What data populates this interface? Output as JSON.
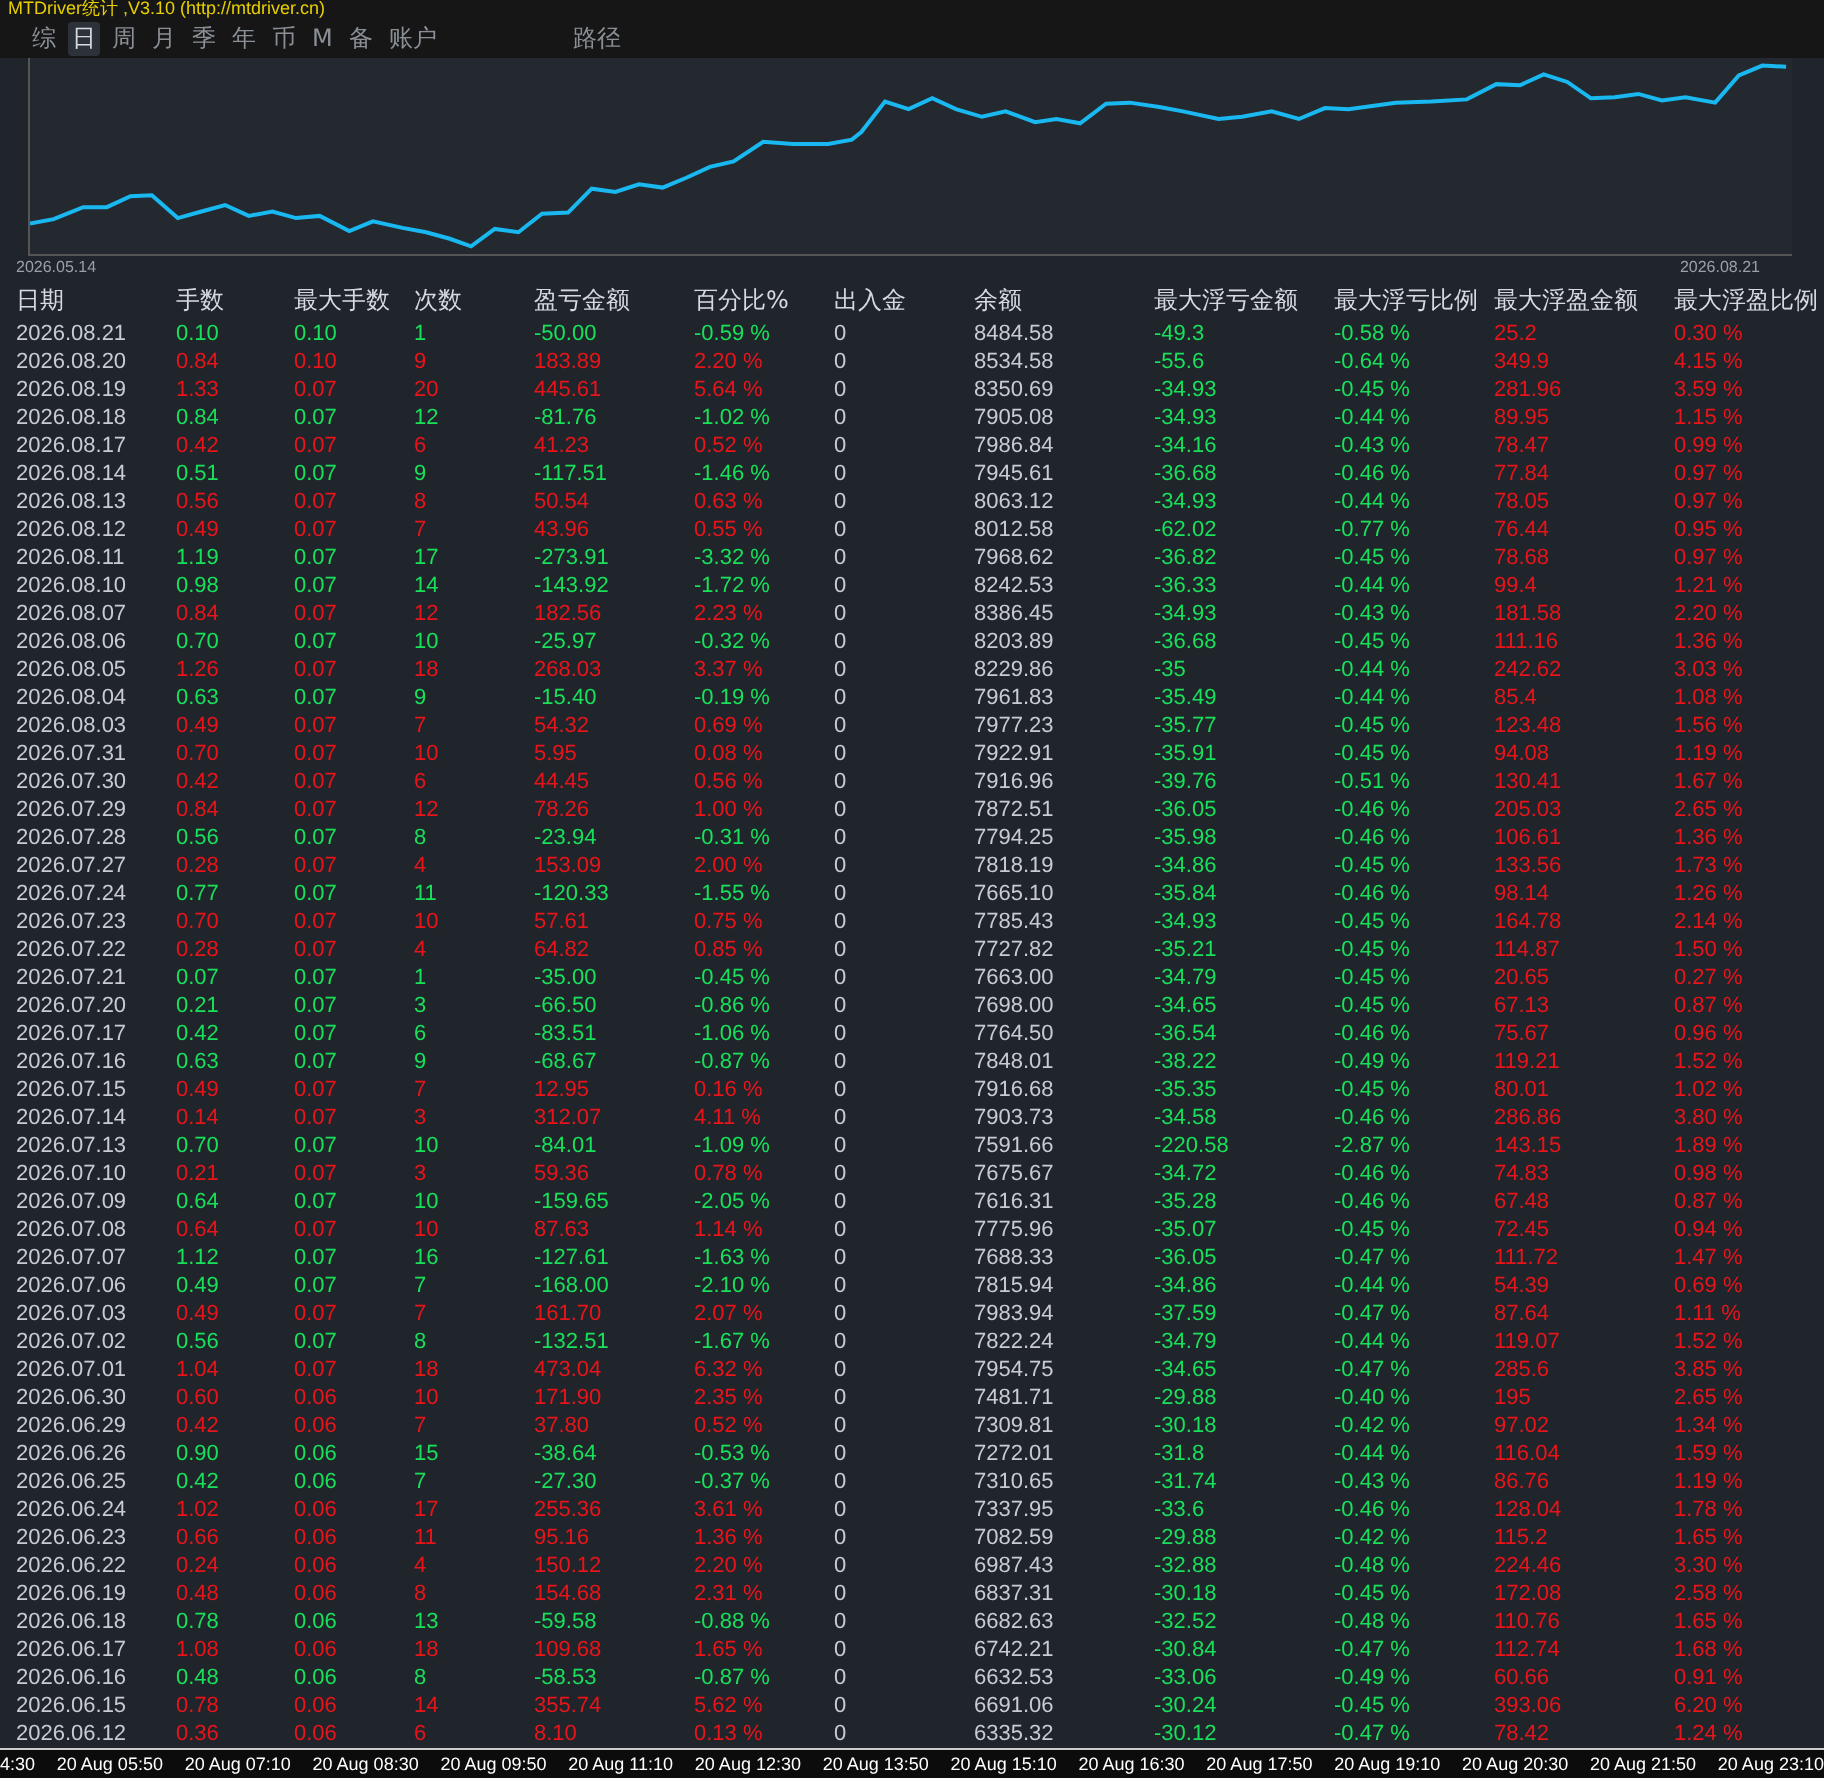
{
  "window": {
    "title": "MTDriver统计 ,V3.10 (http://mtdriver.cn)"
  },
  "tabs": [
    {
      "label": "综",
      "selected": false
    },
    {
      "label": "日",
      "selected": true
    },
    {
      "label": "周",
      "selected": false
    },
    {
      "label": "月",
      "selected": false
    },
    {
      "label": "季",
      "selected": false
    },
    {
      "label": "年",
      "selected": false
    },
    {
      "label": "币",
      "selected": false
    },
    {
      "label": "M",
      "selected": false
    },
    {
      "label": "备",
      "selected": false
    },
    {
      "label": "账户",
      "selected": false
    },
    {
      "label": "路径",
      "selected": false
    }
  ],
  "chart": {
    "start_label": "2026.05.14",
    "end_label": "2026.08.21"
  },
  "table": {
    "columns": [
      "日期",
      "手数",
      "最大手数",
      "次数",
      "盈亏金额",
      "百分比%",
      "出入金",
      "余额",
      "最大浮亏金额",
      "最大浮亏比例",
      "最大浮盈金额",
      "最大浮盈比例"
    ],
    "rows": [
      {
        "kind": "loss",
        "cells": [
          "2026.08.21",
          "0.10",
          "0.10",
          "1",
          "-50.00",
          "-0.59 %",
          "0",
          "8484.58",
          "-49.3",
          "-0.58 %",
          "25.2",
          "0.30 %"
        ]
      },
      {
        "kind": "gain",
        "cells": [
          "2026.08.20",
          "0.84",
          "0.10",
          "9",
          "183.89",
          "2.20 %",
          "0",
          "8534.58",
          "-55.6",
          "-0.64 %",
          "349.9",
          "4.15 %"
        ]
      },
      {
        "kind": "gain",
        "cells": [
          "2026.08.19",
          "1.33",
          "0.07",
          "20",
          "445.61",
          "5.64 %",
          "0",
          "8350.69",
          "-34.93",
          "-0.45 %",
          "281.96",
          "3.59 %"
        ]
      },
      {
        "kind": "loss",
        "cells": [
          "2026.08.18",
          "0.84",
          "0.07",
          "12",
          "-81.76",
          "-1.02 %",
          "0",
          "7905.08",
          "-34.93",
          "-0.44 %",
          "89.95",
          "1.15 %"
        ]
      },
      {
        "kind": "gain",
        "cells": [
          "2026.08.17",
          "0.42",
          "0.07",
          "6",
          "41.23",
          "0.52 %",
          "0",
          "7986.84",
          "-34.16",
          "-0.43 %",
          "78.47",
          "0.99 %"
        ]
      },
      {
        "kind": "loss",
        "cells": [
          "2026.08.14",
          "0.51",
          "0.07",
          "9",
          "-117.51",
          "-1.46 %",
          "0",
          "7945.61",
          "-36.68",
          "-0.46 %",
          "77.84",
          "0.97 %"
        ]
      },
      {
        "kind": "gain",
        "cells": [
          "2026.08.13",
          "0.56",
          "0.07",
          "8",
          "50.54",
          "0.63 %",
          "0",
          "8063.12",
          "-34.93",
          "-0.44 %",
          "78.05",
          "0.97 %"
        ]
      },
      {
        "kind": "gain",
        "cells": [
          "2026.08.12",
          "0.49",
          "0.07",
          "7",
          "43.96",
          "0.55 %",
          "0",
          "8012.58",
          "-62.02",
          "-0.77 %",
          "76.44",
          "0.95 %"
        ]
      },
      {
        "kind": "loss",
        "cells": [
          "2026.08.11",
          "1.19",
          "0.07",
          "17",
          "-273.91",
          "-3.32 %",
          "0",
          "7968.62",
          "-36.82",
          "-0.45 %",
          "78.68",
          "0.97 %"
        ]
      },
      {
        "kind": "loss",
        "cells": [
          "2026.08.10",
          "0.98",
          "0.07",
          "14",
          "-143.92",
          "-1.72 %",
          "0",
          "8242.53",
          "-36.33",
          "-0.44 %",
          "99.4",
          "1.21 %"
        ]
      },
      {
        "kind": "gain",
        "cells": [
          "2026.08.07",
          "0.84",
          "0.07",
          "12",
          "182.56",
          "2.23 %",
          "0",
          "8386.45",
          "-34.93",
          "-0.43 %",
          "181.58",
          "2.20 %"
        ]
      },
      {
        "kind": "loss",
        "cells": [
          "2026.08.06",
          "0.70",
          "0.07",
          "10",
          "-25.97",
          "-0.32 %",
          "0",
          "8203.89",
          "-36.68",
          "-0.45 %",
          "111.16",
          "1.36 %"
        ]
      },
      {
        "kind": "gain",
        "cells": [
          "2026.08.05",
          "1.26",
          "0.07",
          "18",
          "268.03",
          "3.37 %",
          "0",
          "8229.86",
          "-35",
          "-0.44 %",
          "242.62",
          "3.03 %"
        ]
      },
      {
        "kind": "loss",
        "cells": [
          "2026.08.04",
          "0.63",
          "0.07",
          "9",
          "-15.40",
          "-0.19 %",
          "0",
          "7961.83",
          "-35.49",
          "-0.44 %",
          "85.4",
          "1.08 %"
        ]
      },
      {
        "kind": "gain",
        "cells": [
          "2026.08.03",
          "0.49",
          "0.07",
          "7",
          "54.32",
          "0.69 %",
          "0",
          "7977.23",
          "-35.77",
          "-0.45 %",
          "123.48",
          "1.56 %"
        ]
      },
      {
        "kind": "gain",
        "cells": [
          "2026.07.31",
          "0.70",
          "0.07",
          "10",
          "5.95",
          "0.08 %",
          "0",
          "7922.91",
          "-35.91",
          "-0.45 %",
          "94.08",
          "1.19 %"
        ]
      },
      {
        "kind": "gain",
        "cells": [
          "2026.07.30",
          "0.42",
          "0.07",
          "6",
          "44.45",
          "0.56 %",
          "0",
          "7916.96",
          "-39.76",
          "-0.51 %",
          "130.41",
          "1.67 %"
        ]
      },
      {
        "kind": "gain",
        "cells": [
          "2026.07.29",
          "0.84",
          "0.07",
          "12",
          "78.26",
          "1.00 %",
          "0",
          "7872.51",
          "-36.05",
          "-0.46 %",
          "205.03",
          "2.65 %"
        ]
      },
      {
        "kind": "loss",
        "cells": [
          "2026.07.28",
          "0.56",
          "0.07",
          "8",
          "-23.94",
          "-0.31 %",
          "0",
          "7794.25",
          "-35.98",
          "-0.46 %",
          "106.61",
          "1.36 %"
        ]
      },
      {
        "kind": "gain",
        "cells": [
          "2026.07.27",
          "0.28",
          "0.07",
          "4",
          "153.09",
          "2.00 %",
          "0",
          "7818.19",
          "-34.86",
          "-0.45 %",
          "133.56",
          "1.73 %"
        ]
      },
      {
        "kind": "loss",
        "cells": [
          "2026.07.24",
          "0.77",
          "0.07",
          "11",
          "-120.33",
          "-1.55 %",
          "0",
          "7665.10",
          "-35.84",
          "-0.46 %",
          "98.14",
          "1.26 %"
        ]
      },
      {
        "kind": "gain",
        "cells": [
          "2026.07.23",
          "0.70",
          "0.07",
          "10",
          "57.61",
          "0.75 %",
          "0",
          "7785.43",
          "-34.93",
          "-0.45 %",
          "164.78",
          "2.14 %"
        ]
      },
      {
        "kind": "gain",
        "cells": [
          "2026.07.22",
          "0.28",
          "0.07",
          "4",
          "64.82",
          "0.85 %",
          "0",
          "7727.82",
          "-35.21",
          "-0.45 %",
          "114.87",
          "1.50 %"
        ]
      },
      {
        "kind": "loss",
        "cells": [
          "2026.07.21",
          "0.07",
          "0.07",
          "1",
          "-35.00",
          "-0.45 %",
          "0",
          "7663.00",
          "-34.79",
          "-0.45 %",
          "20.65",
          "0.27 %"
        ]
      },
      {
        "kind": "loss",
        "cells": [
          "2026.07.20",
          "0.21",
          "0.07",
          "3",
          "-66.50",
          "-0.86 %",
          "0",
          "7698.00",
          "-34.65",
          "-0.45 %",
          "67.13",
          "0.87 %"
        ]
      },
      {
        "kind": "loss",
        "cells": [
          "2026.07.17",
          "0.42",
          "0.07",
          "6",
          "-83.51",
          "-1.06 %",
          "0",
          "7764.50",
          "-36.54",
          "-0.46 %",
          "75.67",
          "0.96 %"
        ]
      },
      {
        "kind": "loss",
        "cells": [
          "2026.07.16",
          "0.63",
          "0.07",
          "9",
          "-68.67",
          "-0.87 %",
          "0",
          "7848.01",
          "-38.22",
          "-0.49 %",
          "119.21",
          "1.52 %"
        ]
      },
      {
        "kind": "gain",
        "cells": [
          "2026.07.15",
          "0.49",
          "0.07",
          "7",
          "12.95",
          "0.16 %",
          "0",
          "7916.68",
          "-35.35",
          "-0.45 %",
          "80.01",
          "1.02 %"
        ]
      },
      {
        "kind": "gain",
        "cells": [
          "2026.07.14",
          "0.14",
          "0.07",
          "3",
          "312.07",
          "4.11 %",
          "0",
          "7903.73",
          "-34.58",
          "-0.46 %",
          "286.86",
          "3.80 %"
        ]
      },
      {
        "kind": "loss",
        "cells": [
          "2026.07.13",
          "0.70",
          "0.07",
          "10",
          "-84.01",
          "-1.09 %",
          "0",
          "7591.66",
          "-220.58",
          "-2.87 %",
          "143.15",
          "1.89 %"
        ]
      },
      {
        "kind": "gain",
        "cells": [
          "2026.07.10",
          "0.21",
          "0.07",
          "3",
          "59.36",
          "0.78 %",
          "0",
          "7675.67",
          "-34.72",
          "-0.46 %",
          "74.83",
          "0.98 %"
        ]
      },
      {
        "kind": "loss",
        "cells": [
          "2026.07.09",
          "0.64",
          "0.07",
          "10",
          "-159.65",
          "-2.05 %",
          "0",
          "7616.31",
          "-35.28",
          "-0.46 %",
          "67.48",
          "0.87 %"
        ]
      },
      {
        "kind": "gain",
        "cells": [
          "2026.07.08",
          "0.64",
          "0.07",
          "10",
          "87.63",
          "1.14 %",
          "0",
          "7775.96",
          "-35.07",
          "-0.45 %",
          "72.45",
          "0.94 %"
        ]
      },
      {
        "kind": "loss",
        "cells": [
          "2026.07.07",
          "1.12",
          "0.07",
          "16",
          "-127.61",
          "-1.63 %",
          "0",
          "7688.33",
          "-36.05",
          "-0.47 %",
          "111.72",
          "1.47 %"
        ]
      },
      {
        "kind": "loss",
        "cells": [
          "2026.07.06",
          "0.49",
          "0.07",
          "7",
          "-168.00",
          "-2.10 %",
          "0",
          "7815.94",
          "-34.86",
          "-0.44 %",
          "54.39",
          "0.69 %"
        ]
      },
      {
        "kind": "gain",
        "cells": [
          "2026.07.03",
          "0.49",
          "0.07",
          "7",
          "161.70",
          "2.07 %",
          "0",
          "7983.94",
          "-37.59",
          "-0.47 %",
          "87.64",
          "1.11 %"
        ]
      },
      {
        "kind": "loss",
        "cells": [
          "2026.07.02",
          "0.56",
          "0.07",
          "8",
          "-132.51",
          "-1.67 %",
          "0",
          "7822.24",
          "-34.79",
          "-0.44 %",
          "119.07",
          "1.52 %"
        ]
      },
      {
        "kind": "gain",
        "cells": [
          "2026.07.01",
          "1.04",
          "0.07",
          "18",
          "473.04",
          "6.32 %",
          "0",
          "7954.75",
          "-34.65",
          "-0.47 %",
          "285.6",
          "3.85 %"
        ]
      },
      {
        "kind": "gain",
        "cells": [
          "2026.06.30",
          "0.60",
          "0.06",
          "10",
          "171.90",
          "2.35 %",
          "0",
          "7481.71",
          "-29.88",
          "-0.40 %",
          "195",
          "2.65 %"
        ]
      },
      {
        "kind": "gain",
        "cells": [
          "2026.06.29",
          "0.42",
          "0.06",
          "7",
          "37.80",
          "0.52 %",
          "0",
          "7309.81",
          "-30.18",
          "-0.42 %",
          "97.02",
          "1.34 %"
        ]
      },
      {
        "kind": "loss",
        "cells": [
          "2026.06.26",
          "0.90",
          "0.06",
          "15",
          "-38.64",
          "-0.53 %",
          "0",
          "7272.01",
          "-31.8",
          "-0.44 %",
          "116.04",
          "1.59 %"
        ]
      },
      {
        "kind": "loss",
        "cells": [
          "2026.06.25",
          "0.42",
          "0.06",
          "7",
          "-27.30",
          "-0.37 %",
          "0",
          "7310.65",
          "-31.74",
          "-0.43 %",
          "86.76",
          "1.19 %"
        ]
      },
      {
        "kind": "gain",
        "cells": [
          "2026.06.24",
          "1.02",
          "0.06",
          "17",
          "255.36",
          "3.61 %",
          "0",
          "7337.95",
          "-33.6",
          "-0.46 %",
          "128.04",
          "1.78 %"
        ]
      },
      {
        "kind": "gain",
        "cells": [
          "2026.06.23",
          "0.66",
          "0.06",
          "11",
          "95.16",
          "1.36 %",
          "0",
          "7082.59",
          "-29.88",
          "-0.42 %",
          "115.2",
          "1.65 %"
        ]
      },
      {
        "kind": "gain",
        "cells": [
          "2026.06.22",
          "0.24",
          "0.06",
          "4",
          "150.12",
          "2.20 %",
          "0",
          "6987.43",
          "-32.88",
          "-0.48 %",
          "224.46",
          "3.30 %"
        ]
      },
      {
        "kind": "gain",
        "cells": [
          "2026.06.19",
          "0.48",
          "0.06",
          "8",
          "154.68",
          "2.31 %",
          "0",
          "6837.31",
          "-30.18",
          "-0.45 %",
          "172.08",
          "2.58 %"
        ]
      },
      {
        "kind": "loss",
        "cells": [
          "2026.06.18",
          "0.78",
          "0.06",
          "13",
          "-59.58",
          "-0.88 %",
          "0",
          "6682.63",
          "-32.52",
          "-0.48 %",
          "110.76",
          "1.65 %"
        ]
      },
      {
        "kind": "gain",
        "cells": [
          "2026.06.17",
          "1.08",
          "0.06",
          "18",
          "109.68",
          "1.65 %",
          "0",
          "6742.21",
          "-30.84",
          "-0.47 %",
          "112.74",
          "1.68 %"
        ]
      },
      {
        "kind": "loss",
        "cells": [
          "2026.06.16",
          "0.48",
          "0.06",
          "8",
          "-58.53",
          "-0.87 %",
          "0",
          "6632.53",
          "-33.06",
          "-0.49 %",
          "60.66",
          "0.91 %"
        ]
      },
      {
        "kind": "gain",
        "cells": [
          "2026.06.15",
          "0.78",
          "0.06",
          "14",
          "355.74",
          "5.62 %",
          "0",
          "6691.06",
          "-30.24",
          "-0.45 %",
          "393.06",
          "6.20 %"
        ]
      },
      {
        "kind": "gain",
        "cells": [
          "2026.06.12",
          "0.36",
          "0.06",
          "6",
          "8.10",
          "0.13 %",
          "0",
          "6335.32",
          "-30.12",
          "-0.47 %",
          "78.42",
          "1.24 %"
        ]
      }
    ]
  },
  "time_axis": [
    "4:30",
    "20 Aug 05:50",
    "20 Aug 07:10",
    "20 Aug 08:30",
    "20 Aug 09:50",
    "20 Aug 11:10",
    "20 Aug 12:30",
    "20 Aug 13:50",
    "20 Aug 15:10",
    "20 Aug 16:30",
    "20 Aug 17:50",
    "20 Aug 19:10",
    "20 Aug 20:30",
    "20 Aug 21:50",
    "20 Aug 23:10"
  ]
}
